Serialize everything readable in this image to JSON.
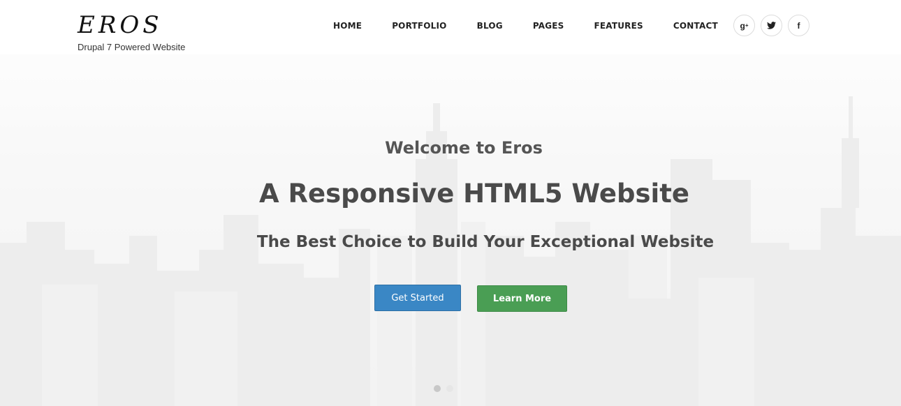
{
  "brand": {
    "name": "EROS",
    "tagline": "Drupal 7 Powered Website"
  },
  "nav": {
    "items": [
      {
        "label": "HOME"
      },
      {
        "label": "PORTFOLIO"
      },
      {
        "label": "BLOG"
      },
      {
        "label": "PAGES"
      },
      {
        "label": "FEATURES"
      },
      {
        "label": "CONTACT"
      }
    ]
  },
  "social": {
    "items": [
      {
        "icon": "google-plus-icon",
        "glyph": "g⁺"
      },
      {
        "icon": "twitter-icon",
        "glyph": "🐦"
      },
      {
        "icon": "facebook-icon",
        "glyph": "f"
      }
    ]
  },
  "hero": {
    "welcome": "Welcome to Eros",
    "headline": "A Responsive HTML5 Website",
    "subheadline": "The Best Choice to Build Your Exceptional Website",
    "primary_button": "Get Started",
    "secondary_button": "Learn More",
    "slider_dots": 2,
    "active_dot": 0
  },
  "colors": {
    "primary_button": "#3a87c5",
    "secondary_button": "#4a9e54"
  }
}
